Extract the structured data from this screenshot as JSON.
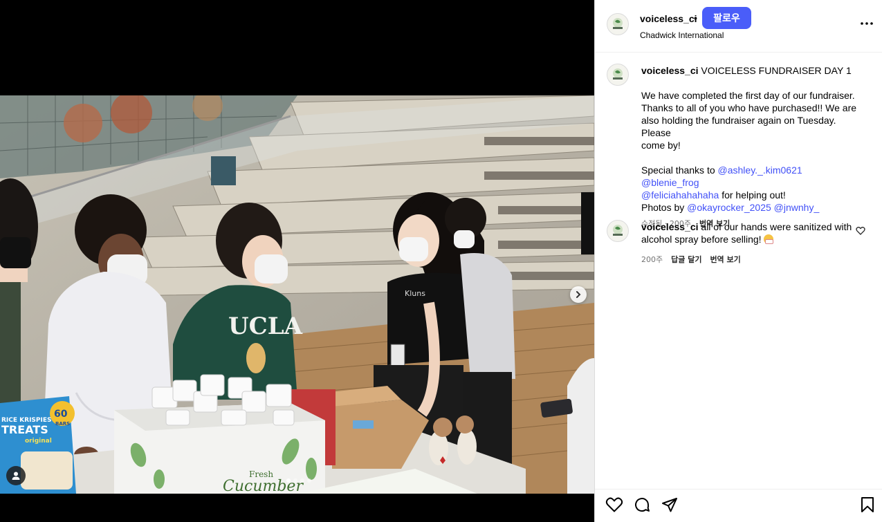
{
  "post": {
    "username": "voiceless_ci",
    "follow_label": "팔로우",
    "location": "Chadwick International",
    "caption": {
      "headline": "VOICELESS FUNDRAISER DAY 1",
      "para1": [
        "We have completed the first day of our fundraiser.",
        "Thanks to all of you who have purchased!! We are",
        "also holding the fundraiser again on Tuesday. Please",
        "come by!"
      ],
      "thanks_prefix": "Special thanks to",
      "thanks_mentions": [
        "@ashley._.kim0621",
        "@blenie_frog",
        "@feliciahahahaha"
      ],
      "thanks_suffix": "for helping out!",
      "photos_prefix": "Photos by",
      "photos_mentions": [
        "@okayrocker_2025",
        "@jnwnhy_"
      ],
      "meta_edited": "수정됨 · 200주",
      "meta_translate": "번역 보기"
    },
    "comment": {
      "username": "voiceless_ci",
      "text": "all of our hands were sanitized with alcohol spray before selling!",
      "emoji": "mask-face-emoji",
      "time": "200주",
      "reply_label": "답글 달기",
      "translate_label": "번역 보기"
    }
  },
  "photo": {
    "cup_brand": "UCLA",
    "snack_box": {
      "count": "60",
      "unit": "BARS",
      "line1": "RICE KRISPIES",
      "line2": "TREATS",
      "line3": "original"
    },
    "crate_text": {
      "line1": "Fresh",
      "line2": "Cucumber"
    },
    "shirt_text": "Kluns"
  },
  "carousel": {
    "dots": 4,
    "active": 1
  },
  "icons": [
    "like-icon",
    "comment-icon",
    "share-icon",
    "save-icon",
    "more-options-icon",
    "next-arrow-icon",
    "user-tag-icon"
  ],
  "colors": {
    "follow_button": "#4a5df9",
    "mention": "#4150f7",
    "muted": "#737373"
  }
}
